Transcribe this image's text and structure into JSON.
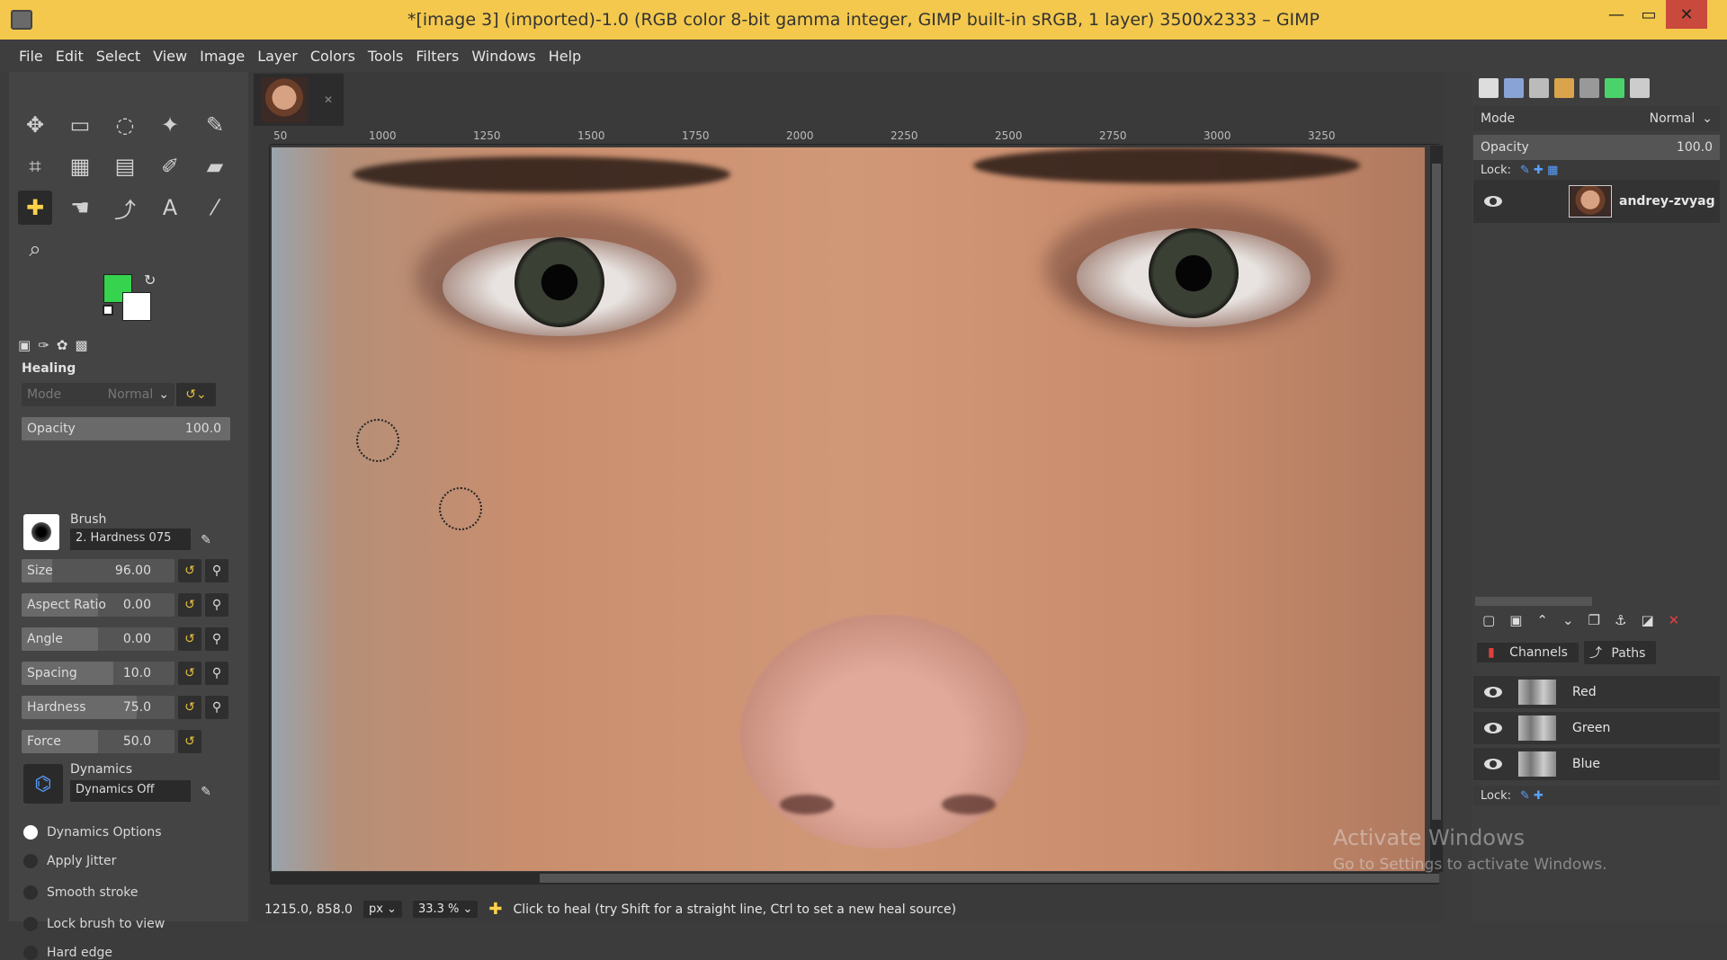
{
  "window": {
    "title": "*[image 3] (imported)-1.0 (RGB color 8-bit gamma integer, GIMP built-in sRGB, 1 layer) 3500x2333 – GIMP"
  },
  "menu": [
    "File",
    "Edit",
    "Select",
    "View",
    "Image",
    "Layer",
    "Colors",
    "Tools",
    "Filters",
    "Windows",
    "Help"
  ],
  "tool_options": {
    "title": "Healing",
    "mode_label": "Mode",
    "mode_value": "Normal",
    "opacity_label": "Opacity",
    "opacity_value": "100.0",
    "brush_label": "Brush",
    "brush_value": "2. Hardness 075",
    "size_label": "Size",
    "size_value": "96.00",
    "aspect_label": "Aspect Ratio",
    "aspect_value": "0.00",
    "angle_label": "Angle",
    "angle_value": "0.00",
    "spacing_label": "Spacing",
    "spacing_value": "10.0",
    "hardness_label": "Hardness",
    "hardness_value": "75.0",
    "force_label": "Force",
    "force_value": "50.0",
    "dynamics_label": "Dynamics",
    "dynamics_value": "Dynamics Off",
    "dyn_options": "Dynamics Options",
    "apply_jitter": "Apply Jitter",
    "smooth_stroke": "Smooth stroke",
    "lock_brush": "Lock brush to view",
    "hard_edge": "Hard edge"
  },
  "ruler_ticks": [
    "50",
    "1000",
    "1250",
    "1500",
    "1750",
    "2000",
    "2250",
    "2500",
    "2750",
    "3000",
    "3250"
  ],
  "status": {
    "coords": "1215.0, 858.0",
    "unit": "px",
    "zoom": "33.3 %",
    "message": "Click to heal (try Shift for a straight line, Ctrl to set a new heal source)"
  },
  "layers_panel": {
    "mode_label": "Mode",
    "mode_value": "Normal",
    "opacity_label": "Opacity",
    "opacity_value": "100.0",
    "lock_label": "Lock:",
    "layer_name": "andrey-zvyag"
  },
  "channels_panel": {
    "tab_channels": "Channels",
    "tab_paths": "Paths",
    "channels": [
      "Red",
      "Green",
      "Blue"
    ],
    "lock_label": "Lock:"
  },
  "watermark": {
    "line1": "Activate Windows",
    "line2": "Go to Settings to activate Windows."
  },
  "colors": {
    "foreground": "#35d34e",
    "background": "#ffffff"
  }
}
